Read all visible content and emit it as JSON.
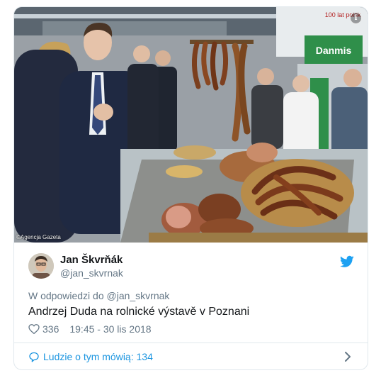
{
  "photo": {
    "credit": "©Agencja Gazeta",
    "info_icon": "info-icon",
    "sign_brand": "Danmis",
    "sign_banner": "100 lat polsk"
  },
  "author": {
    "name": "Jan Škvrňák",
    "handle": "@jan_skvrnak",
    "avatar_icon": "avatar"
  },
  "reply_to": "W odpowiedzi do @jan_skvrnak",
  "tweet_text": "Andrzej Duda na rolnické výstavě v Poznani",
  "meta": {
    "likes": "336",
    "timestamp": "19:45 - 30 lis 2018"
  },
  "footer": {
    "label": "Ludzie o tym mówią: 134"
  },
  "colors": {
    "twitter_blue": "#1da1f2",
    "link_blue": "#1b95e0",
    "secondary_text": "#657786",
    "border": "#e1e8ed"
  }
}
